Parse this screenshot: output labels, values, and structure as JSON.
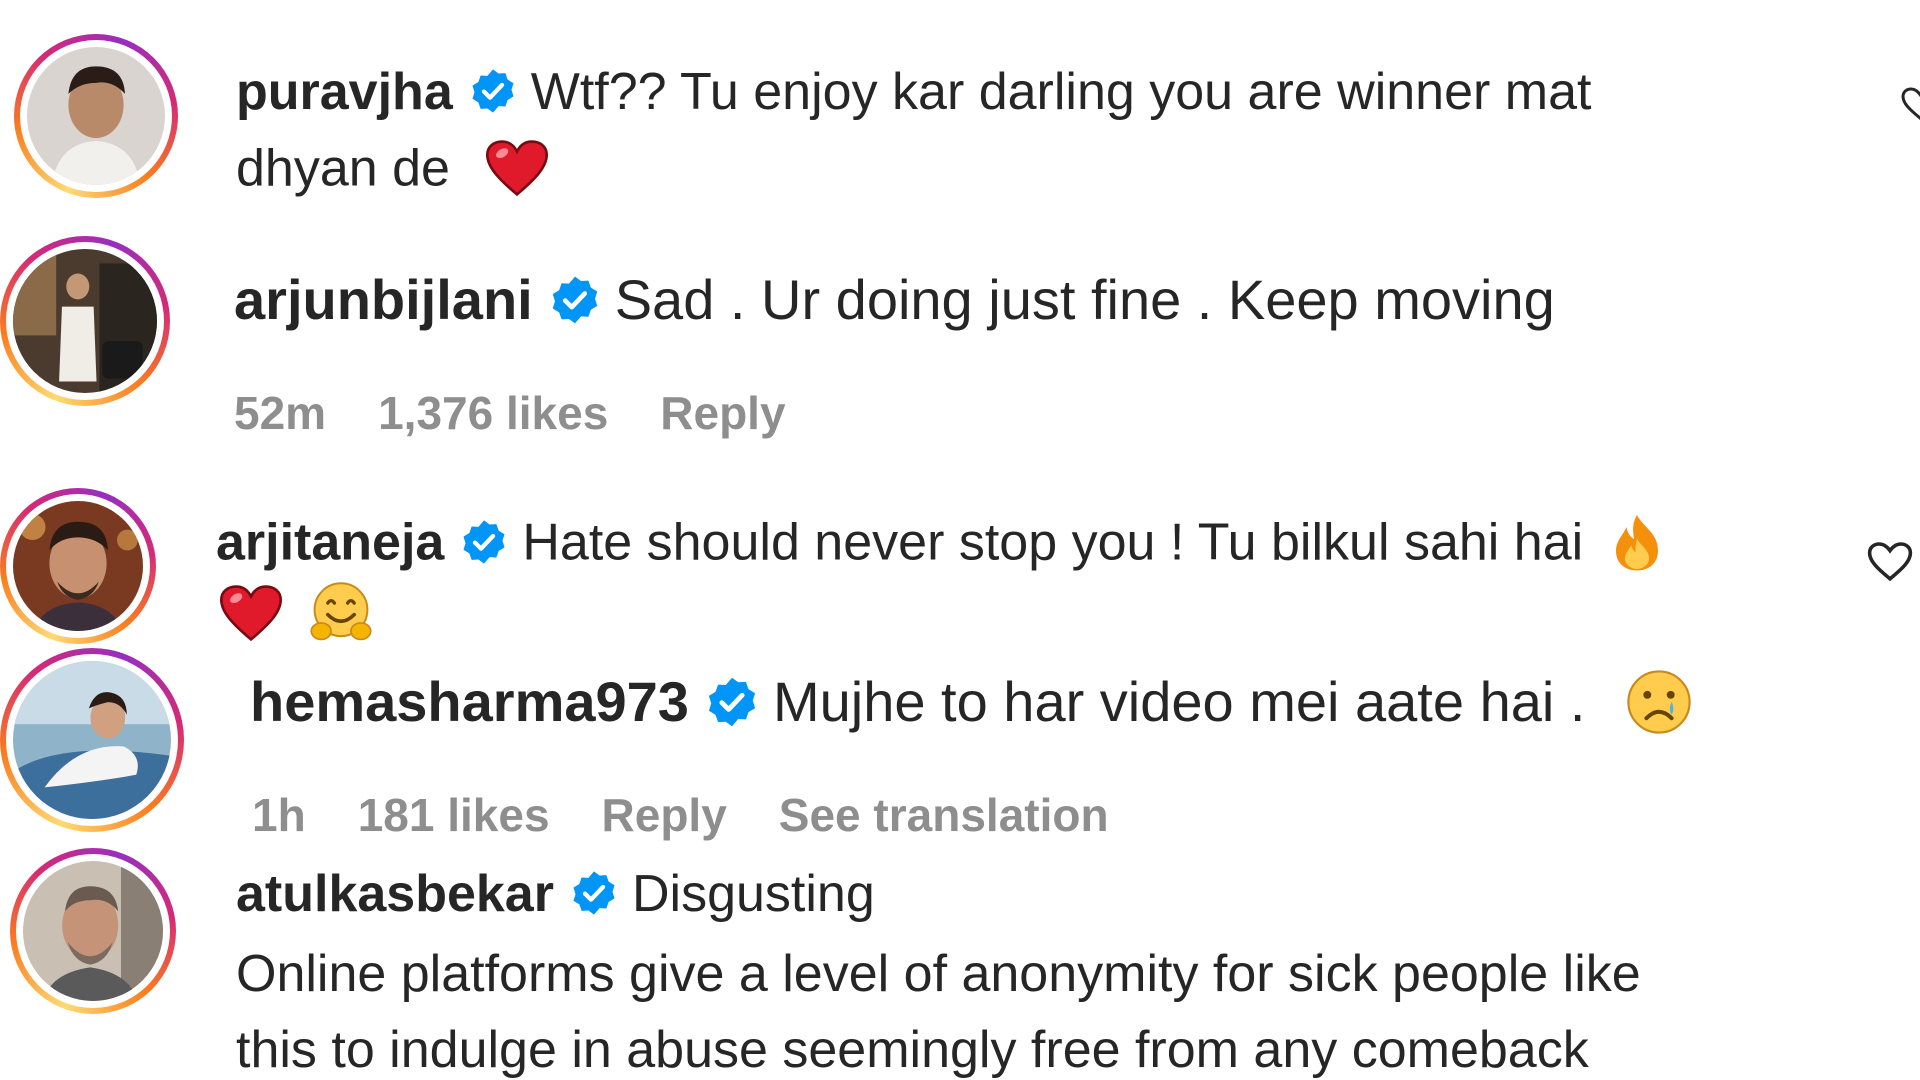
{
  "comments": [
    {
      "username": "puravjha",
      "text_line1": "Wtf?? Tu enjoy kar darling you are winner mat",
      "text_line2": "dhyan de",
      "emoji": [
        "red-heart"
      ]
    },
    {
      "username": "arjunbijlani",
      "text_line1": "Sad . Ur doing just fine . Keep moving",
      "time": "52m",
      "likes": "1,376 likes",
      "reply": "Reply"
    },
    {
      "username": "arjitaneja",
      "text_line1": "Hate should never stop you ! Tu bilkul sahi hai",
      "emoji": [
        "fire",
        "red-heart",
        "hugging-face"
      ]
    },
    {
      "username": "hemasharma973",
      "text_line1": "Mujhe to har video mei aate hai .",
      "emoji": [
        "crying-face"
      ],
      "time": "1h",
      "likes": "181 likes",
      "reply": "Reply",
      "see_translation": "See translation"
    },
    {
      "username": "atulkasbekar",
      "text_line1": "Disgusting",
      "text_line2": "Online platforms give a level of anonymity for sick people like",
      "text_line3": "this to indulge in abuse seemingly free from any comeback"
    }
  ],
  "colors": {
    "text": "#262626",
    "muted": "#8e8e8e",
    "verified": "#0095f6",
    "ring_gradient": [
      "#feda75",
      "#fa7e1e",
      "#d62976",
      "#962fbf"
    ]
  }
}
